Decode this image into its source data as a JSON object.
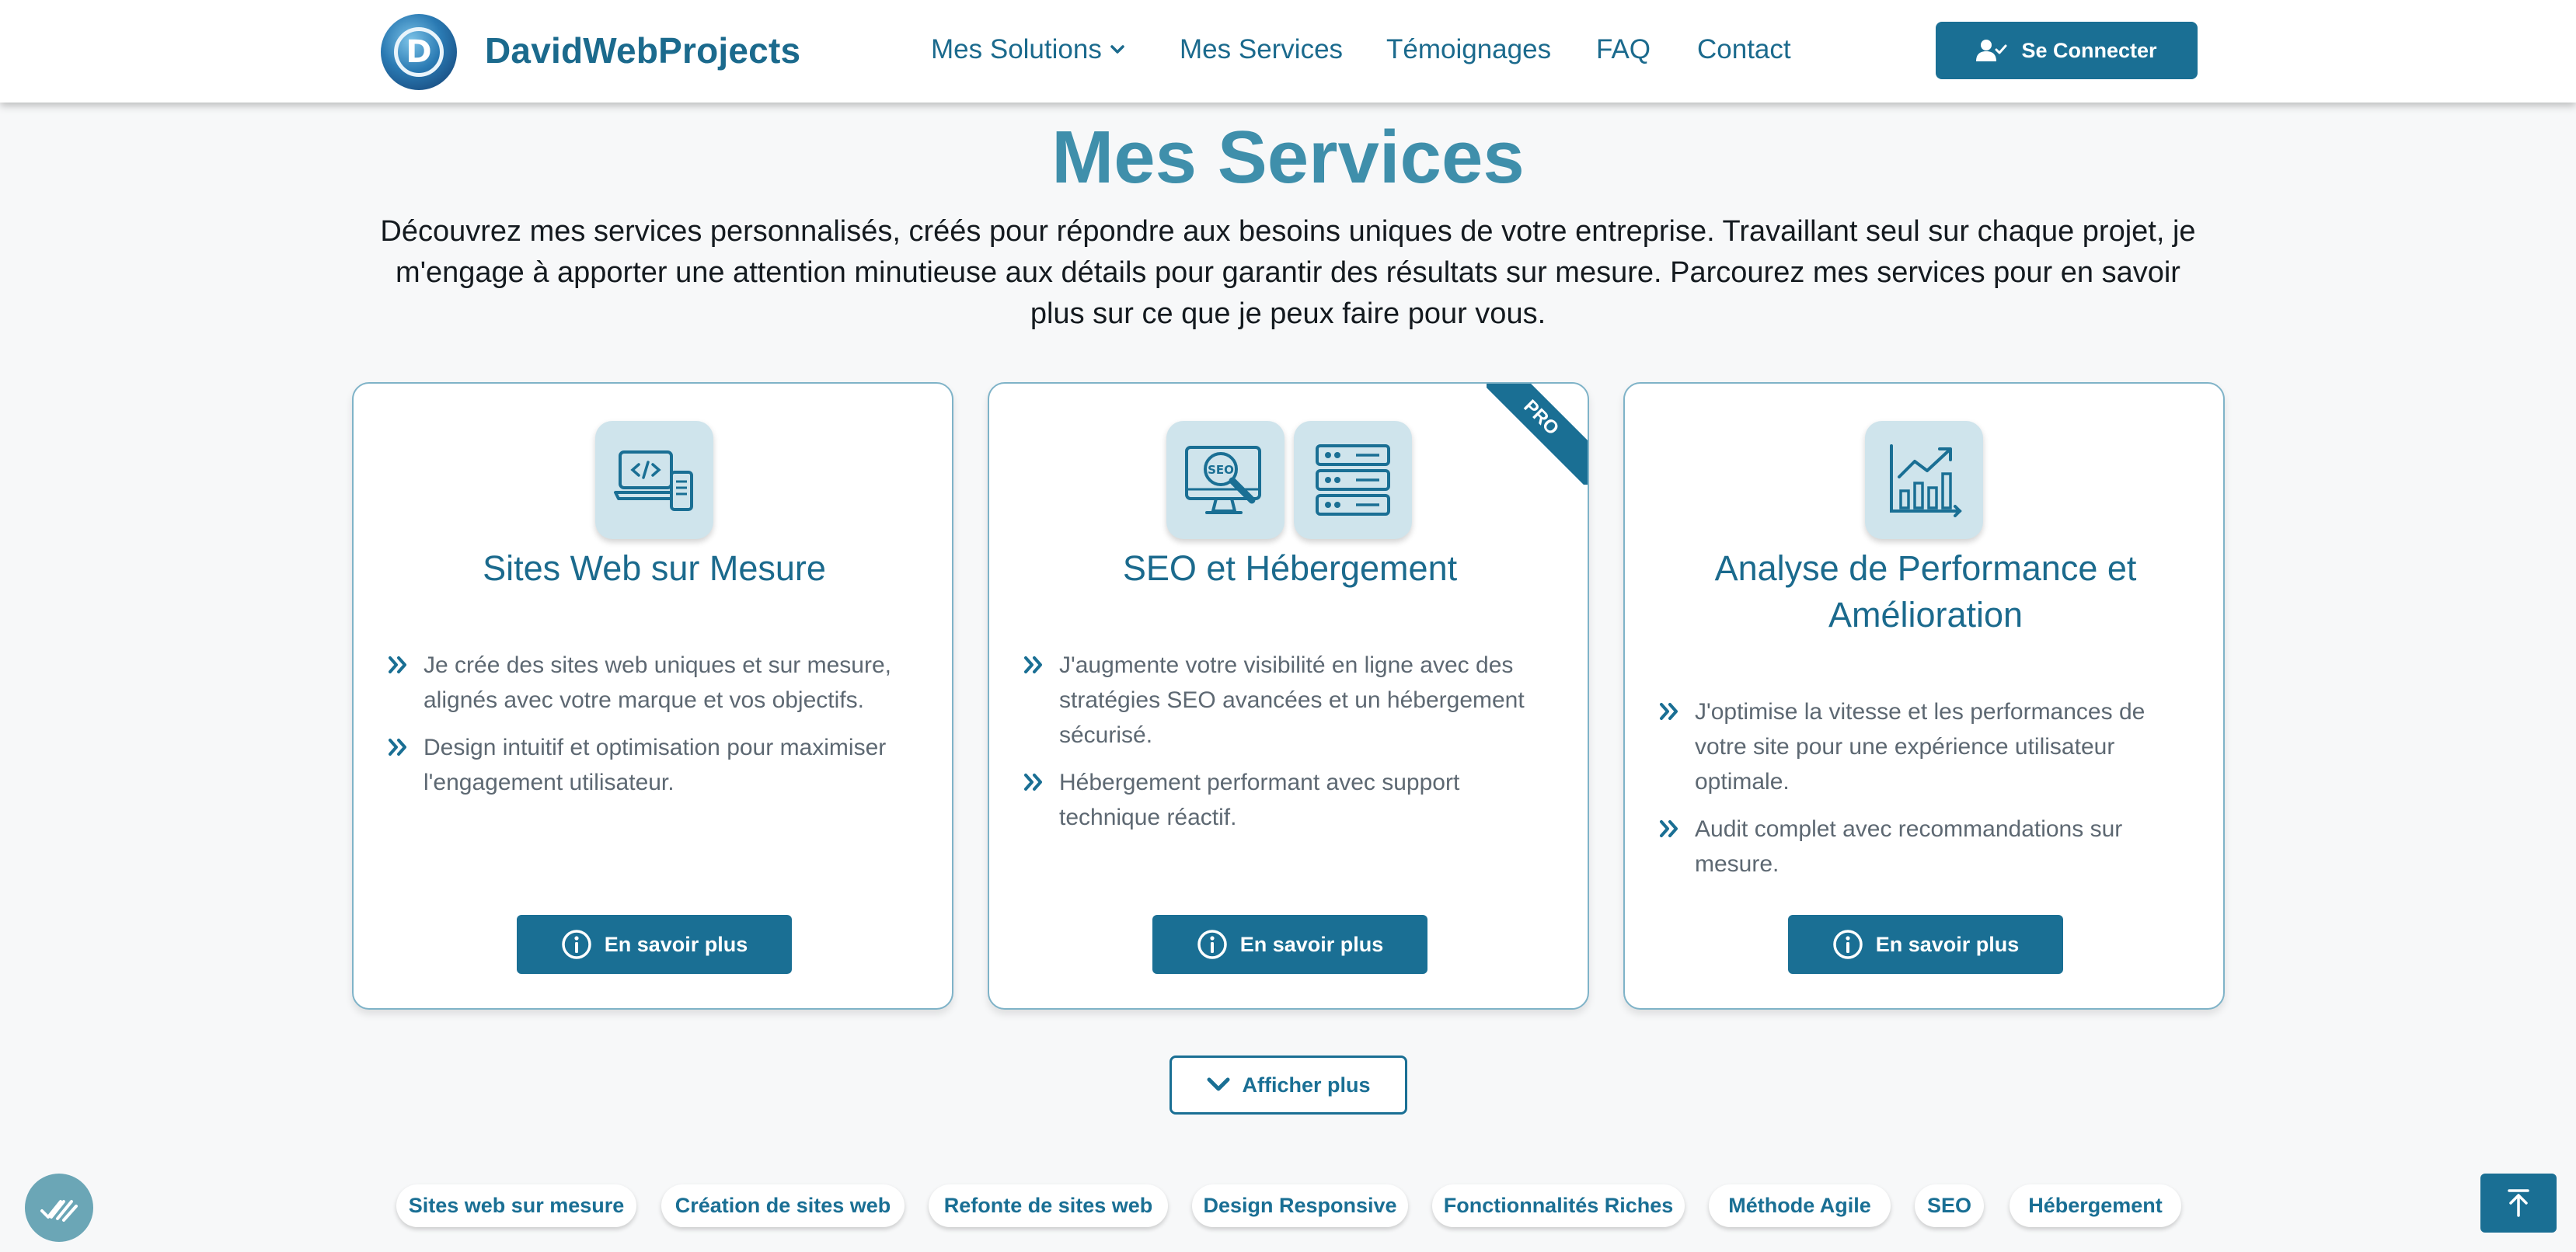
{
  "header": {
    "brand": "DavidWebProjects",
    "logo_letter": "D",
    "nav": {
      "solutions": "Mes Solutions",
      "services": "Mes Services",
      "temoignages": "Témoignages",
      "faq": "FAQ",
      "contact": "Contact"
    },
    "login_label": "Se Connecter"
  },
  "main": {
    "title": "Mes Services",
    "intro": "Découvrez mes services personnalisés, créés pour répondre aux besoins uniques de votre entreprise. Travaillant seul sur chaque projet, je m'engage à apporter une attention minutieuse aux détails pour garantir des résultats sur mesure. Parcourez mes services pour en savoir plus sur ce que je peux faire pour vous."
  },
  "cards": [
    {
      "title": "Sites Web sur Mesure",
      "icons": [
        "laptop-code-icon"
      ],
      "bullets": [
        "Je crée des sites web uniques et sur mesure, alignés avec votre marque et vos objectifs.",
        "Design intuitif et optimisation pour maximiser l'engagement utilisateur."
      ],
      "button": "En savoir plus"
    },
    {
      "title": "SEO et Hébergement",
      "badge": "PRO",
      "icons": [
        "seo-monitor-icon",
        "server-icon"
      ],
      "bullets": [
        "J'augmente votre visibilité en ligne avec des stratégies SEO avancées et un hébergement sécurisé.",
        "Hébergement performant avec support technique réactif."
      ],
      "button": "En savoir plus"
    },
    {
      "title": "Analyse de Performance et Amélioration",
      "icons": [
        "growth-chart-icon"
      ],
      "bullets": [
        "J'optimise la vitesse et les performances de votre site pour une expérience utilisateur optimale.",
        "Audit complet avec recommandations sur mesure."
      ],
      "button": "En savoir plus"
    }
  ],
  "show_more": "Afficher plus",
  "tags": [
    "Sites web sur mesure",
    "Création de sites web",
    "Refonte de sites web",
    "Design Responsive",
    "Fonctionnalités Riches",
    "Méthode Agile",
    "SEO",
    "Hébergement"
  ],
  "colors": {
    "primary": "#1a6f94",
    "title": "#3f8fab",
    "card_border": "#7fb3c8",
    "icon_tile": "#cfe4ec",
    "background": "#f7f8f9"
  }
}
